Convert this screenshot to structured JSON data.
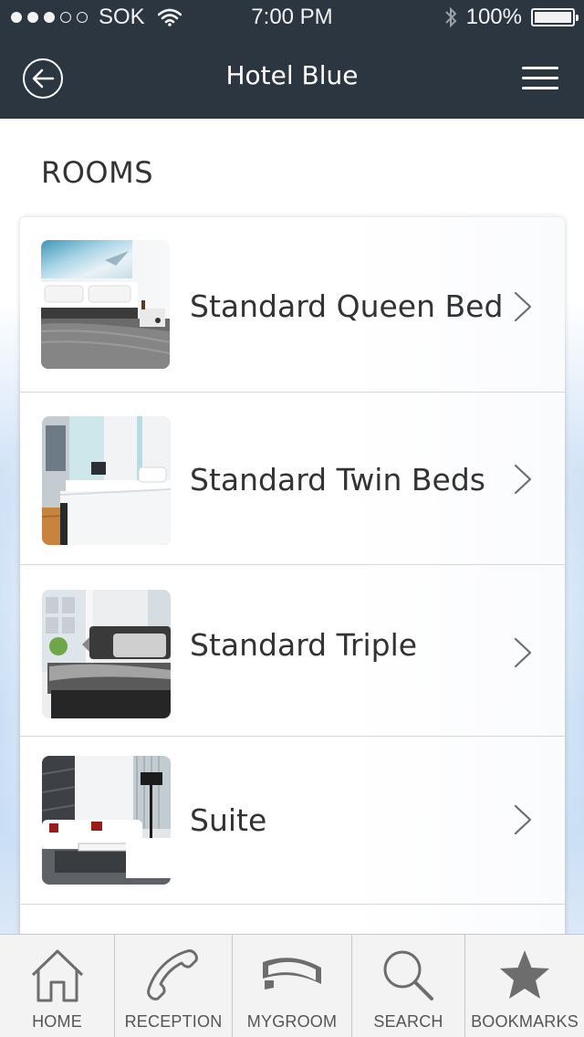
{
  "status_bar": {
    "carrier": "SOK",
    "time": "7:00 PM",
    "battery": "100%"
  },
  "header": {
    "title": "Hotel Blue",
    "back_icon": "back-arrow-circle-icon",
    "menu_icon": "hamburger-menu-icon"
  },
  "section": {
    "title": "ROOMS"
  },
  "rooms": [
    {
      "label": "Standard Queen Bed",
      "icon": "chevron-right-icon"
    },
    {
      "label": "Standard Twin Beds",
      "icon": "chevron-right-icon"
    },
    {
      "label": "Standard Triple",
      "icon": "chevron-right-icon"
    },
    {
      "label": "Suite",
      "icon": "chevron-right-icon"
    }
  ],
  "tabbar": {
    "tabs": [
      {
        "label": "HOME",
        "icon": "home-icon"
      },
      {
        "label": "RECEPTION",
        "icon": "phone-icon"
      },
      {
        "label": "MYGROOM",
        "icon": "room-key-icon"
      },
      {
        "label": "SEARCH",
        "icon": "search-icon"
      },
      {
        "label": "BOOKMARKS",
        "icon": "star-icon"
      }
    ]
  },
  "colors": {
    "header_bg": "#2c3640",
    "text_dark": "#333333",
    "tabbar_bg": "#f3f3f3",
    "icon_gray": "#6d6d6d"
  }
}
